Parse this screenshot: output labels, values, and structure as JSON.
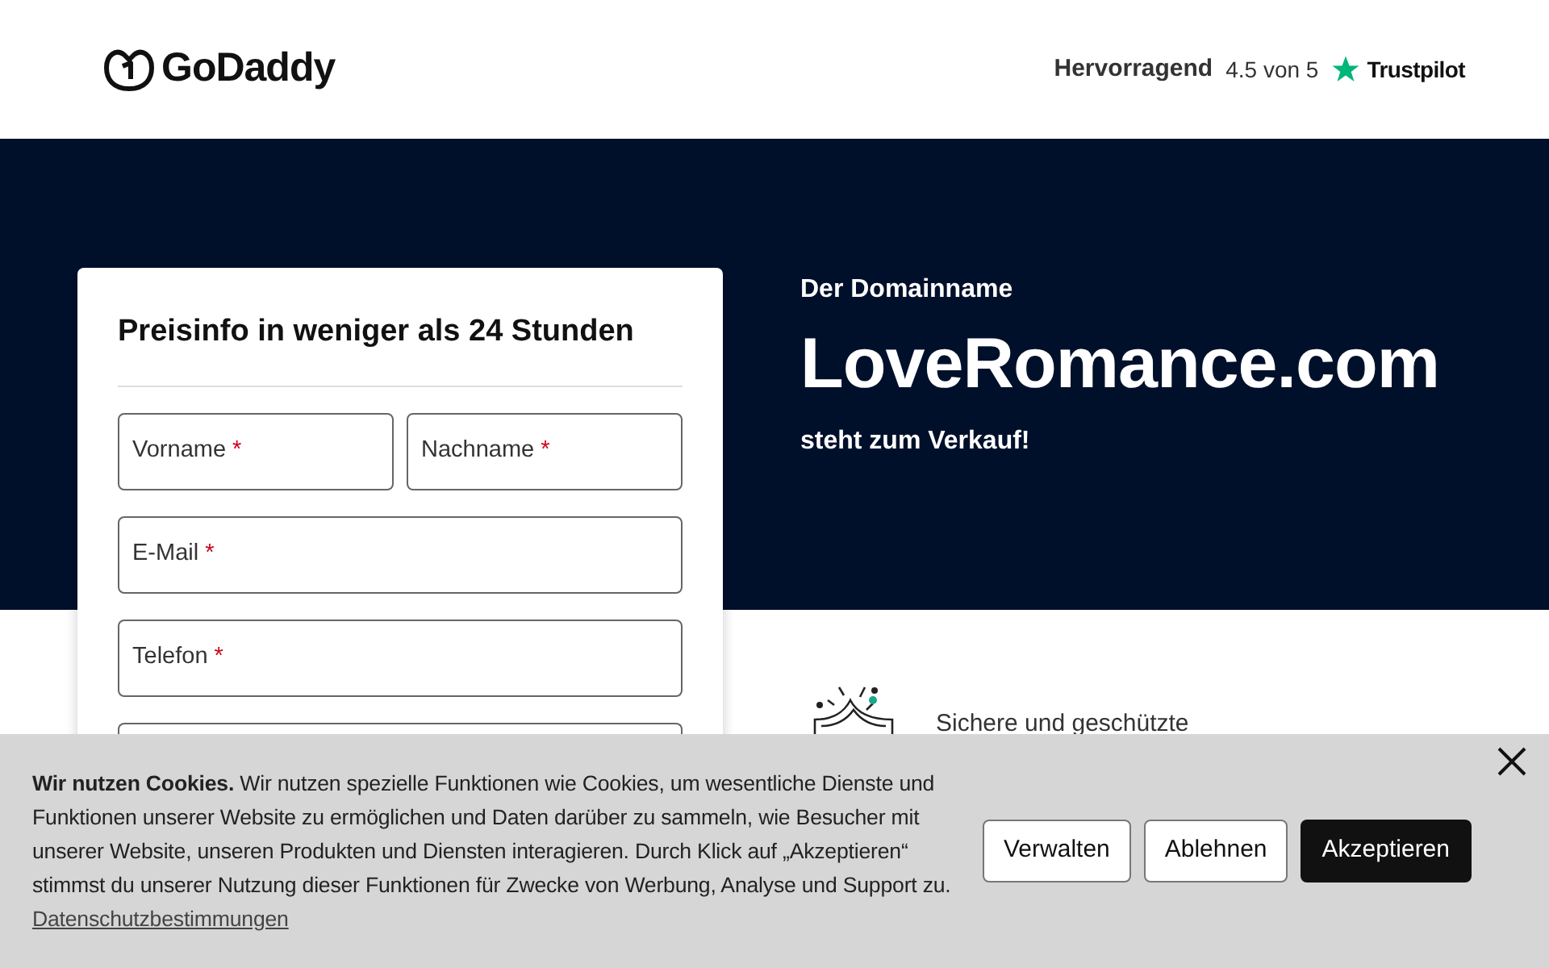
{
  "header": {
    "logo_text": "GoDaddy",
    "rating_label": "Hervorragend",
    "rating_score": "4.5 von 5",
    "rating_brand": "Trustpilot"
  },
  "hero": {
    "eyebrow": "Der Domainname",
    "domain": "LoveRomance.com",
    "subtitle": "steht zum Verkauf!"
  },
  "form": {
    "title": "Preisinfo in weniger als 24 Stunden",
    "fields": [
      {
        "label": "Vorname",
        "required_mark": "*",
        "half": true
      },
      {
        "label": "Nachname",
        "required_mark": "*",
        "half": true
      },
      {
        "label": "E-Mail",
        "required_mark": "*",
        "half": false
      },
      {
        "label": "Telefon",
        "required_mark": "*",
        "half": false
      },
      {
        "half": false
      }
    ]
  },
  "features": [
    {
      "text": "Sichere und geschützte"
    }
  ],
  "cookie_banner": {
    "text": "**Wir nutzen Cookies.** Wir nutzen spezielle Funktionen wie Cookies, um wesentliche Dienste und Funktionen unserer Website zu ermöglichen und Daten darüber zu sammeln, wie Besucher mit unserer Website, unseren Produkten und Diensten interagieren. Durch Klick auf „Akzeptieren“ stimmst du unserer Nutzung dieser Funktionen für Zwecke von Werbung, Analyse und Support zu.",
    "link": "Datenschutzbestimmungen",
    "buttons": [
      {
        "label": "Verwalten",
        "kind": "outline"
      },
      {
        "label": "Ablehnen",
        "kind": "outline"
      },
      {
        "label": "Akzeptieren",
        "kind": "primary"
      }
    ]
  }
}
